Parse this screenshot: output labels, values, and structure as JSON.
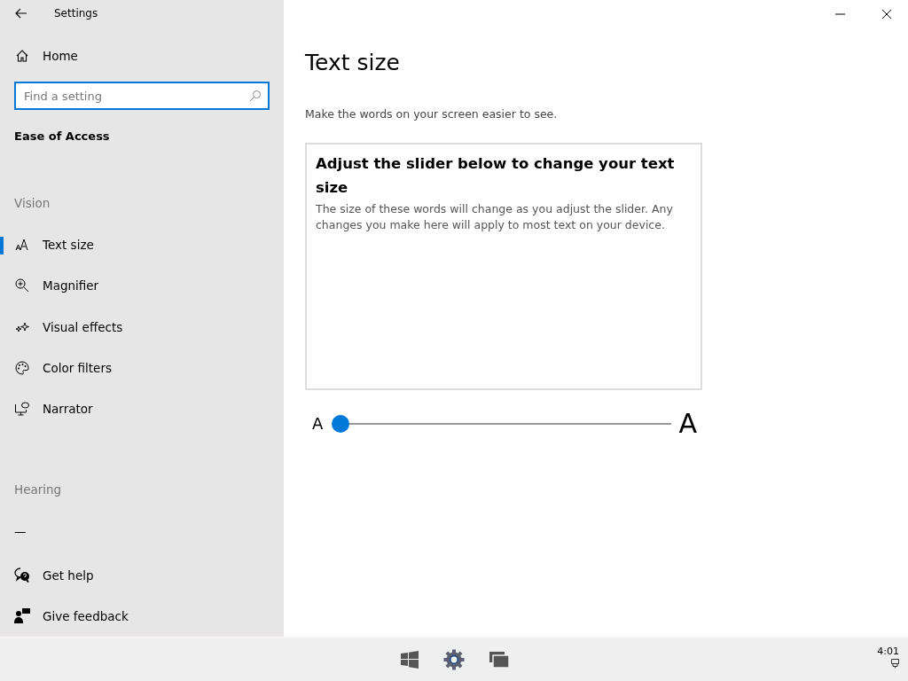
{
  "window": {
    "title": "Settings"
  },
  "sidebar": {
    "home": "Home",
    "search": {
      "placeholder": "Find a setting"
    },
    "section_title": "Ease of Access",
    "groups": [
      {
        "heading": "Vision",
        "items": [
          {
            "label": "Text size",
            "kind": "text-size",
            "selected": true
          },
          {
            "label": "Magnifier",
            "kind": "magnifier",
            "selected": false
          },
          {
            "label": "Visual effects",
            "kind": "sparkle",
            "selected": false
          },
          {
            "label": "Color filters",
            "kind": "palette",
            "selected": false
          },
          {
            "label": "Narrator",
            "kind": "narrator",
            "selected": false
          }
        ]
      },
      {
        "heading": "Hearing",
        "items": [
          {
            "label": "—",
            "kind": "none",
            "selected": false
          }
        ]
      }
    ],
    "footer": [
      {
        "label": "Get help",
        "kind": "help"
      },
      {
        "label": "Give feedback",
        "kind": "feedback"
      }
    ]
  },
  "page": {
    "title": "Text size",
    "description": "Make the words on your screen easier to see.",
    "preview": {
      "heading": "Adjust the slider below to change your text size",
      "body": "The size of these words will change as you adjust the slider. Any changes you make here will apply to most text on your device."
    },
    "slider": {
      "min_label": "A",
      "max_label": "A",
      "level": 0
    }
  },
  "taskbar": {
    "time": "4:01"
  }
}
